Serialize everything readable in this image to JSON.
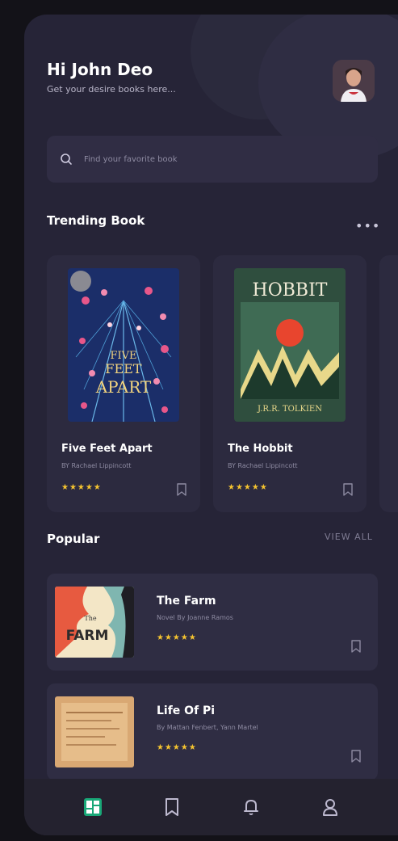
{
  "header": {
    "greeting": "Hi John Deo",
    "subtitle": "Get your desire books here..."
  },
  "search": {
    "placeholder": "Find your favorite book"
  },
  "trending": {
    "title": "Trending Book",
    "more_label": "•••",
    "books": [
      {
        "title": "Five Feet Apart",
        "author": "BY Rachael Lippincott",
        "rating": "★★★★★"
      },
      {
        "title": "The Hobbit",
        "author": "BY Rachael Lippincott",
        "rating": "★★★★★"
      }
    ],
    "covers": {
      "hobbit_title": "HOBBIT",
      "hobbit_author": "J.R.R. TOLKIEN",
      "fivefeet_line1": "FIVE",
      "fivefeet_line2": "FEET",
      "fivefeet_line3": "APART"
    }
  },
  "popular": {
    "title": "Popular",
    "view_all_label": "VIEW ALL",
    "books": [
      {
        "title": "The Farm",
        "author": "Novel By Joanne Ramos",
        "rating": "★★★★★",
        "cover_text": "FARM",
        "cover_small": "The"
      },
      {
        "title": "Life Of Pi",
        "author": "By Mattan Fenbert, Yann Martel",
        "rating": "★★★★★"
      }
    ]
  },
  "colors": {
    "background": "#262437",
    "card": "#2c2a3f",
    "accent": "#19a878",
    "star": "#f5c430"
  },
  "tabs": {
    "icons": [
      "dashboard-icon",
      "bookmark-icon",
      "bell-icon",
      "user-icon"
    ],
    "active_index": 0
  }
}
